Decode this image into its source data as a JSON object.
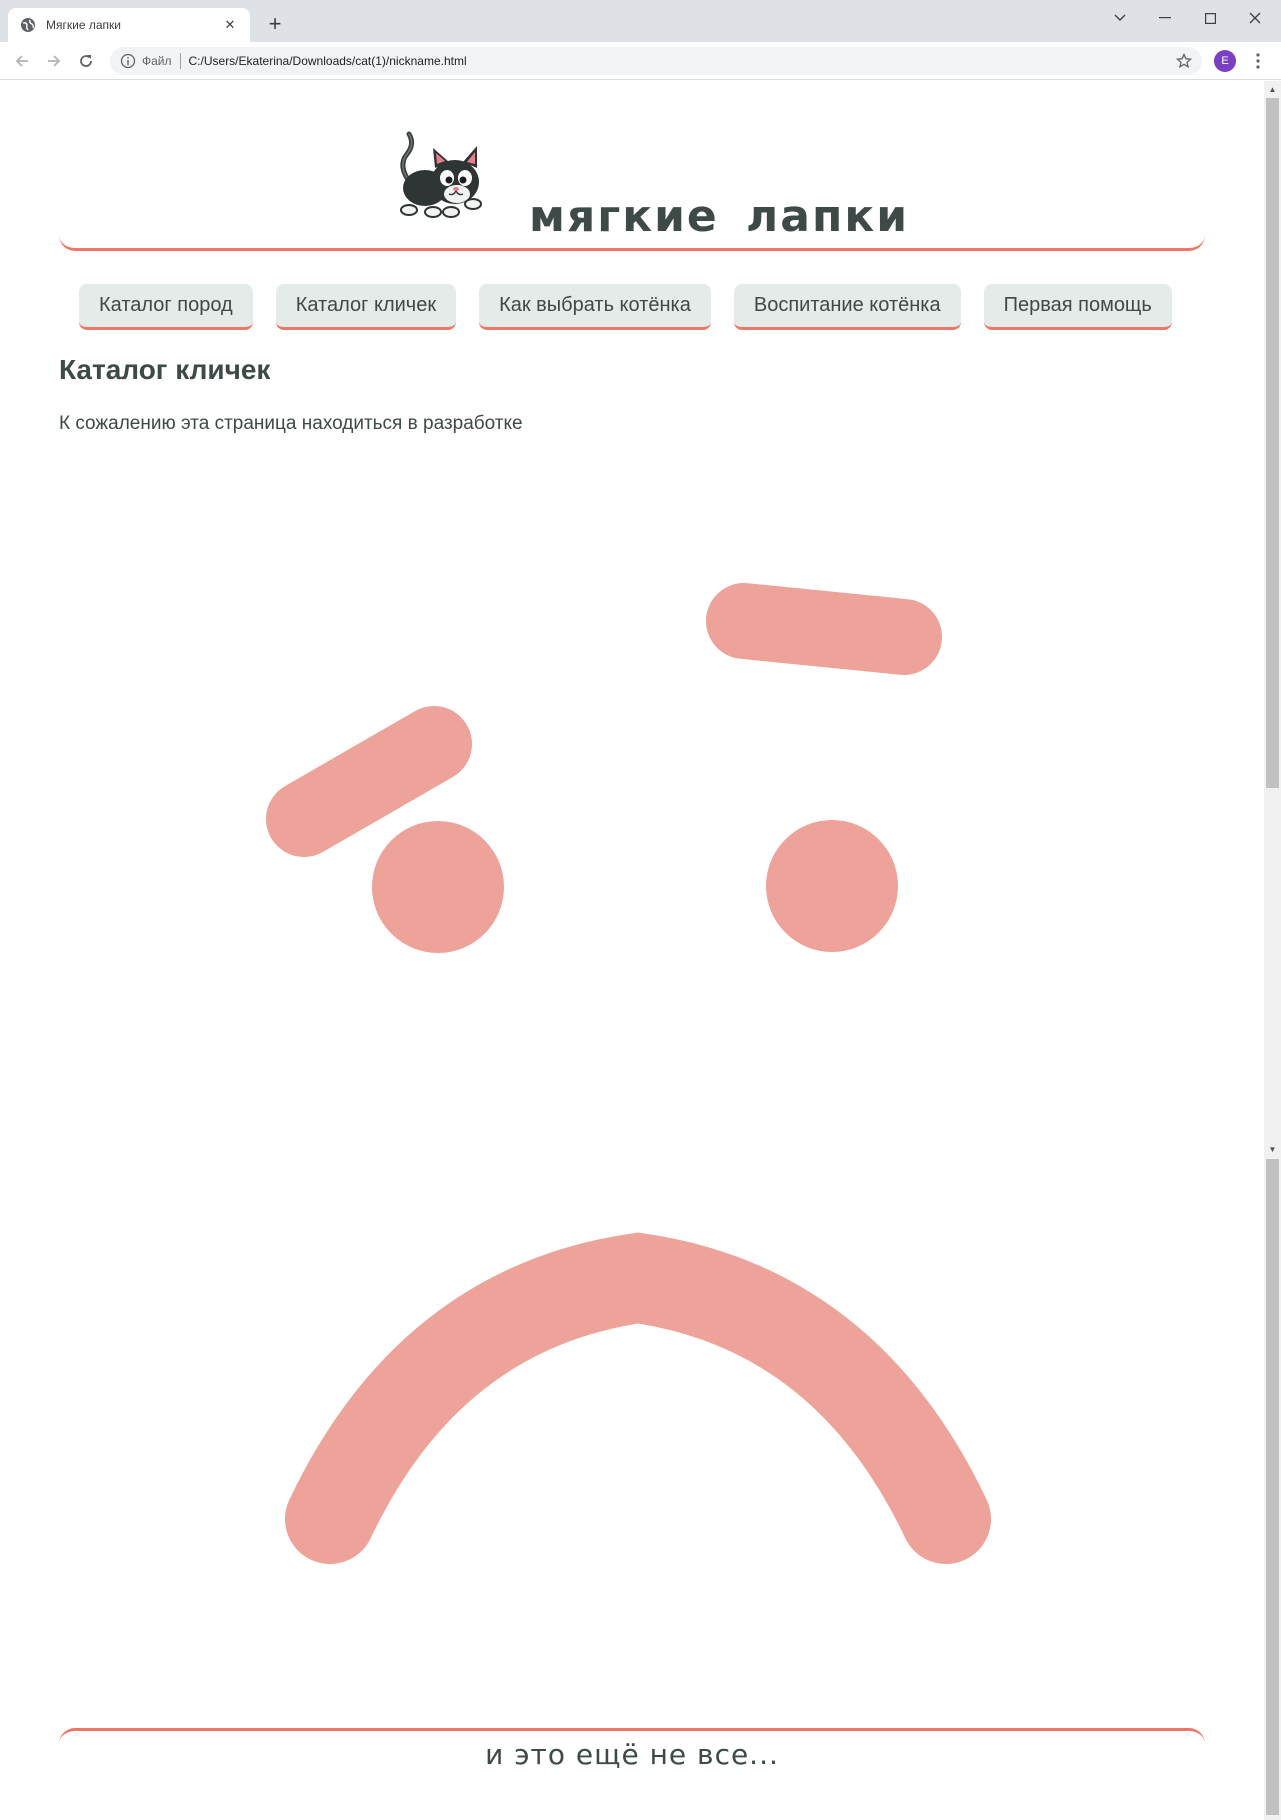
{
  "browser": {
    "tab_title": "Мягкие лапки",
    "tab_close": "✕",
    "new_tab": "+",
    "scheme_label": "Файл",
    "url": "C:/Users/Ekaterina/Downloads/cat(1)/nickname.html",
    "profile_initial": "E"
  },
  "site": {
    "title": "мягкие лапки",
    "nav": [
      "Каталог пород",
      "Каталог кличек",
      "Как выбрать котёнка",
      "Воспитание котёнка",
      "Первая помощь"
    ],
    "heading": "Каталог кличек",
    "text": "К сожалению эта страница находиться в разработке",
    "footer": "и это ещё не все..."
  },
  "colors": {
    "accent": "#ee7765",
    "face": "#eea39a",
    "nav_bg": "#e4ebe8",
    "text": "#3d4a48"
  }
}
